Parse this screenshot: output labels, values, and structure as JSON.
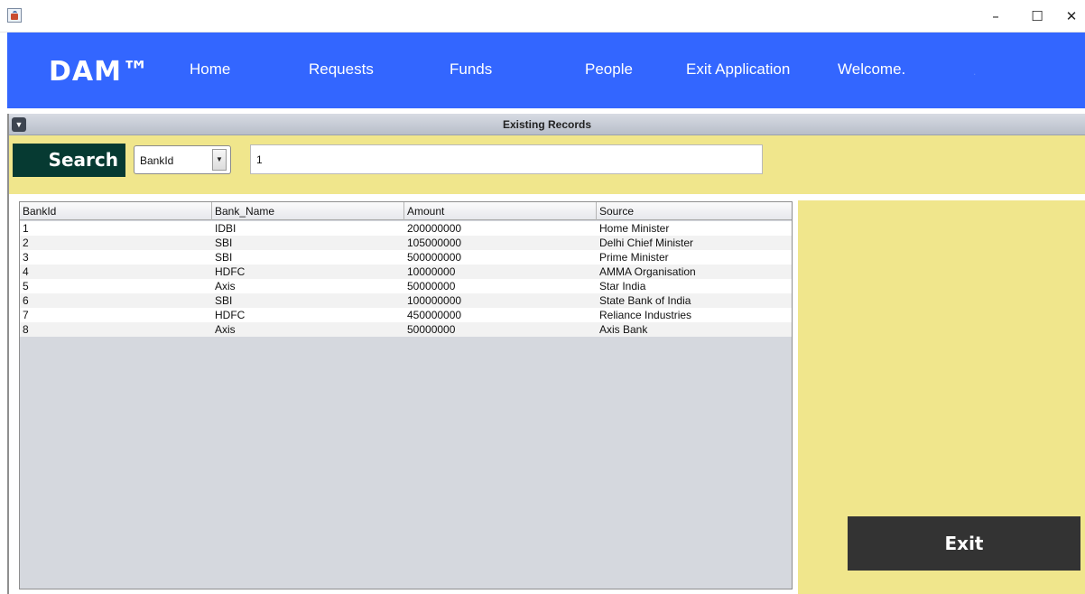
{
  "window": {
    "min_glyph": "–",
    "max_glyph": "☐",
    "close_glyph": "✕"
  },
  "header": {
    "logo": "DAM™",
    "nav": {
      "home": "Home",
      "requests": "Requests",
      "funds": "Funds",
      "people": "People",
      "exit_app": "Exit Application",
      "welcome": "Welcome.",
      "user": "."
    },
    "color": "#3366ff"
  },
  "frame": {
    "title": "Existing Records",
    "toggle_glyph": "▼"
  },
  "search": {
    "label": "Search",
    "field_selected": "BankId",
    "combo_arrow": "▼",
    "query": "1"
  },
  "table": {
    "columns": [
      "BankId",
      "Bank_Name",
      "Amount",
      "Source"
    ],
    "rows": [
      [
        "1",
        "IDBI",
        "200000000",
        "Home Minister"
      ],
      [
        "2",
        "SBI",
        "105000000",
        "Delhi Chief Minister"
      ],
      [
        "3",
        "SBI",
        "500000000",
        "Prime Minister"
      ],
      [
        "4",
        "HDFC",
        "10000000",
        "AMMA Organisation"
      ],
      [
        "5",
        "Axis",
        "50000000",
        "Star India"
      ],
      [
        "6",
        "SBI",
        "100000000",
        "State Bank of India"
      ],
      [
        "7",
        "HDFC",
        "450000000",
        "Reliance Industries"
      ],
      [
        "8",
        "Axis",
        "50000000",
        "Axis Bank"
      ]
    ]
  },
  "side": {
    "exit_label": "Exit",
    "panel_color": "#f0e68c"
  }
}
